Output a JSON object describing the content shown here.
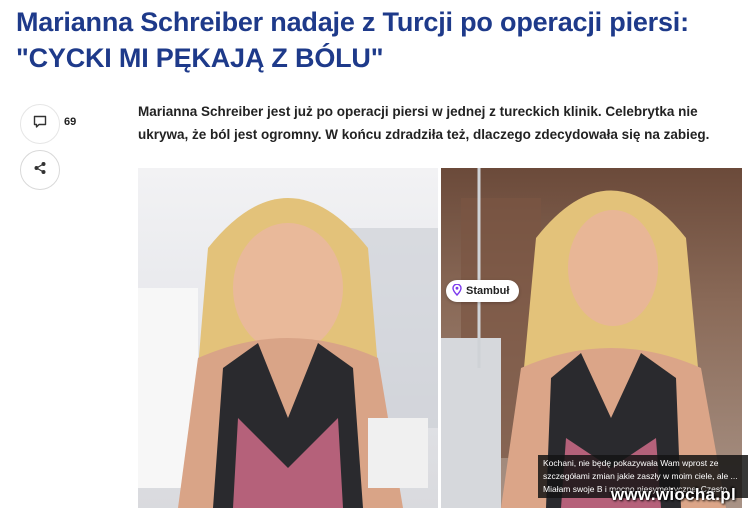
{
  "article": {
    "title": "Marianna Schreiber nadaje z Turcji po operacji piersi: \"CYCKI MI PĘKAJĄ Z BÓLU\"",
    "lead": "Marianna Schreiber jest już po operacji piersi w jednej z tureckich klinik. Celebrytka nie ukrywa, że ból jest ogromny. W końcu zdradziła też, dlaczego zdecydowała się na zabieg."
  },
  "actions": {
    "comment_count": "69"
  },
  "media": {
    "location_tag": "Stambuł",
    "caption": "Kochani, nie będę pokazywała Wam wprost ze szczegółami zmian jakie zaszły w moim ciele, ale ... Miałam swoje B i mocno niesymetryczne. Często",
    "watermark": "www.wiocha.pl"
  },
  "icons": {
    "comment": "comment-icon",
    "share": "share-icon",
    "location": "location-pin-icon"
  },
  "colors": {
    "headline": "#1e3a8a"
  }
}
